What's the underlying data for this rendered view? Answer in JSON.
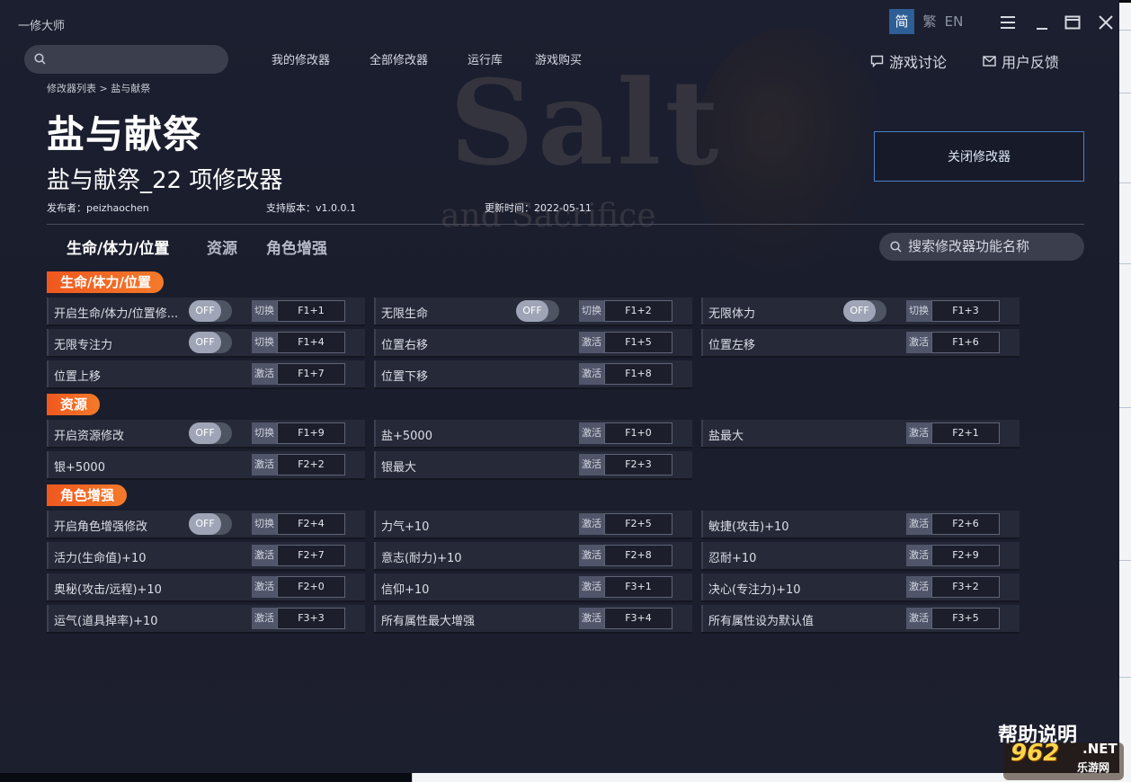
{
  "app": {
    "title": "一修大师"
  },
  "nav": {
    "items": [
      "我的修改器",
      "全部修改器",
      "运行库",
      "游戏购买"
    ]
  },
  "topright": {
    "discuss": "游戏讨论",
    "feedback": "用户反馈"
  },
  "lang": {
    "simplified": "简",
    "traditional": "繁",
    "english": "EN",
    "active": "简"
  },
  "breadcrumb": "修改器列表 > 盐与献祭",
  "game": {
    "title": "盐与献祭",
    "trainer_title": "盐与献祭_22 项修改器",
    "publisher": "发布者：peizhaochen",
    "version": "支持版本：v1.0.0.1",
    "updated": "更新时间：2022-05-11",
    "close_button": "关闭修改器"
  },
  "tabs": [
    "生命/体力/位置",
    "资源",
    "角色增强"
  ],
  "search": {
    "placeholder": "搜索修改器功能名称"
  },
  "background_art": {
    "word": "Salt",
    "subtitle": "and Sacrifice"
  },
  "toggle_label": "OFF",
  "sections": [
    {
      "title": "生命/体力/位置",
      "rows": [
        [
          {
            "label": "开启生命/体力/位置修...",
            "toggle": true,
            "kind": "切换",
            "key": "F1+1"
          },
          {
            "label": "无限生命",
            "toggle": true,
            "kind": "切换",
            "key": "F1+2"
          },
          {
            "label": "无限体力",
            "toggle": true,
            "kind": "切换",
            "key": "F1+3"
          }
        ],
        [
          {
            "label": "无限专注力",
            "toggle": true,
            "kind": "切换",
            "key": "F1+4"
          },
          {
            "label": "位置右移",
            "toggle": false,
            "kind": "激活",
            "key": "F1+5"
          },
          {
            "label": "位置左移",
            "toggle": false,
            "kind": "激活",
            "key": "F1+6"
          }
        ],
        [
          {
            "label": "位置上移",
            "toggle": false,
            "kind": "激活",
            "key": "F1+7"
          },
          {
            "label": "位置下移",
            "toggle": false,
            "kind": "激活",
            "key": "F1+8"
          }
        ]
      ]
    },
    {
      "title": "资源",
      "rows": [
        [
          {
            "label": "开启资源修改",
            "toggle": true,
            "kind": "切换",
            "key": "F1+9"
          },
          {
            "label": "盐+5000",
            "toggle": false,
            "kind": "激活",
            "key": "F1+0"
          },
          {
            "label": "盐最大",
            "toggle": false,
            "kind": "激活",
            "key": "F2+1"
          }
        ],
        [
          {
            "label": "银+5000",
            "toggle": false,
            "kind": "激活",
            "key": "F2+2"
          },
          {
            "label": "银最大",
            "toggle": false,
            "kind": "激活",
            "key": "F2+3"
          }
        ]
      ]
    },
    {
      "title": "角色增强",
      "rows": [
        [
          {
            "label": "开启角色增强修改",
            "toggle": true,
            "kind": "切换",
            "key": "F2+4"
          },
          {
            "label": "力气+10",
            "toggle": false,
            "kind": "激活",
            "key": "F2+5"
          },
          {
            "label": "敏捷(攻击)+10",
            "toggle": false,
            "kind": "激活",
            "key": "F2+6"
          }
        ],
        [
          {
            "label": "活力(生命值)+10",
            "toggle": false,
            "kind": "激活",
            "key": "F2+7"
          },
          {
            "label": "意志(耐力)+10",
            "toggle": false,
            "kind": "激活",
            "key": "F2+8"
          },
          {
            "label": "忍耐+10",
            "toggle": false,
            "kind": "激活",
            "key": "F2+9"
          }
        ],
        [
          {
            "label": "奥秘(攻击/远程)+10",
            "toggle": false,
            "kind": "激活",
            "key": "F2+0"
          },
          {
            "label": "信仰+10",
            "toggle": false,
            "kind": "激活",
            "key": "F3+1"
          },
          {
            "label": "决心(专注力)+10",
            "toggle": false,
            "kind": "激活",
            "key": "F3+2"
          }
        ],
        [
          {
            "label": "运气(道具掉率)+10",
            "toggle": false,
            "kind": "激活",
            "key": "F3+3"
          },
          {
            "label": "所有属性最大增强",
            "toggle": false,
            "kind": "激活",
            "key": "F3+4"
          },
          {
            "label": "所有属性设为默认值",
            "toggle": false,
            "kind": "激活",
            "key": "F3+5"
          }
        ]
      ]
    }
  ],
  "help": "帮助说明",
  "watermark": {
    "logo": "962",
    "net": ".NET",
    "sub": "乐游网"
  },
  "colors": {
    "accent_orange": "#f0581e",
    "accent_blue": "#2e5e96",
    "panel": "#262a38",
    "background": "#1b1f2f"
  }
}
